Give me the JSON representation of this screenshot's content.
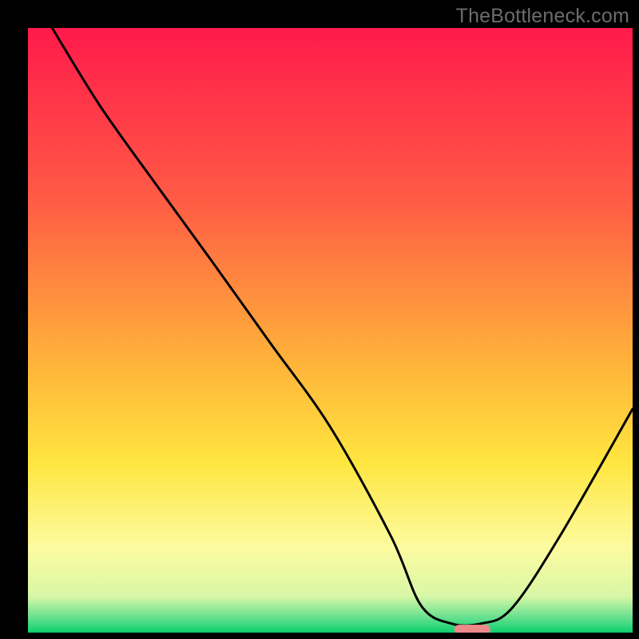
{
  "watermark": "TheBottleneck.com",
  "chart_data": {
    "type": "line",
    "title": "",
    "xlabel": "",
    "ylabel": "",
    "xlim": [
      0,
      100
    ],
    "ylim": [
      0,
      100
    ],
    "grid": false,
    "legend": false,
    "background_gradient": {
      "stops": [
        {
          "pct": 0,
          "color": "#ff1a4b"
        },
        {
          "pct": 28,
          "color": "#ff5a45"
        },
        {
          "pct": 55,
          "color": "#ffb23a"
        },
        {
          "pct": 72,
          "color": "#ffe640"
        },
        {
          "pct": 86,
          "color": "#fdfba0"
        },
        {
          "pct": 94,
          "color": "#d8f7a6"
        },
        {
          "pct": 97.5,
          "color": "#66e08f"
        },
        {
          "pct": 100,
          "color": "#0bd06e"
        }
      ]
    },
    "series": [
      {
        "name": "bottleneck-curve",
        "color": "#000000",
        "x": [
          4,
          12,
          22,
          30,
          40,
          50,
          60,
          65,
          70,
          75,
          80,
          88,
          100
        ],
        "y": [
          100,
          87,
          73,
          62,
          48,
          34,
          16,
          4.5,
          1.5,
          1.5,
          4,
          16,
          37
        ]
      }
    ],
    "markers": [
      {
        "name": "optimal-marker",
        "shape": "rounded-rect",
        "color": "#ec8a8a",
        "x_start": 70.5,
        "x_end": 76.5,
        "y": 0.5,
        "height_pct": 1.6
      }
    ]
  }
}
